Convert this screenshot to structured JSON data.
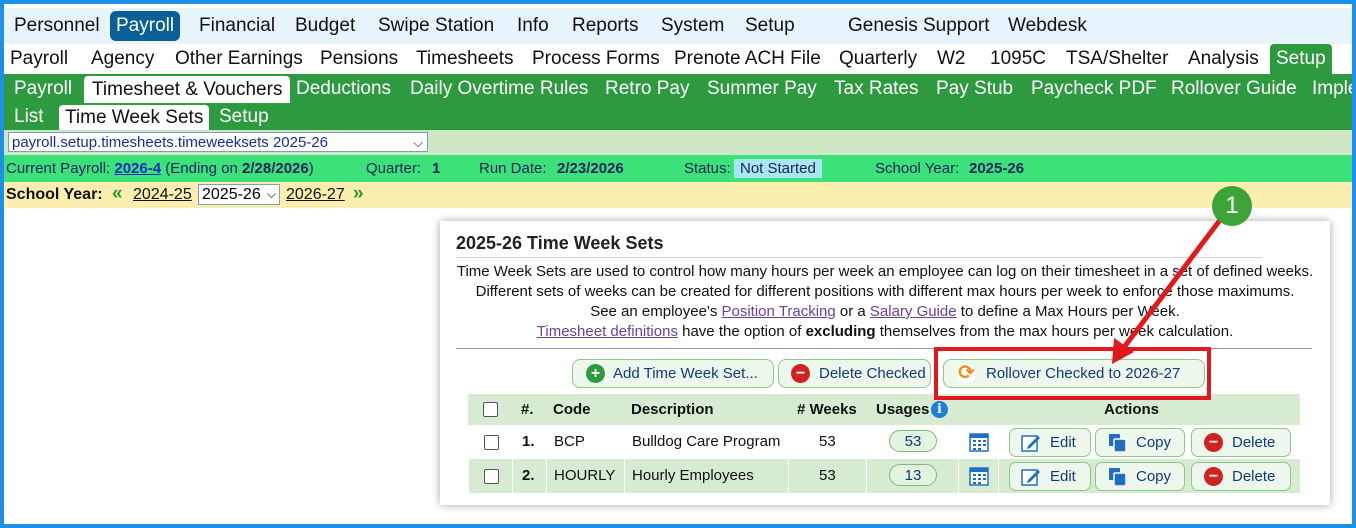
{
  "top_menu": [
    "Personnel",
    "Payroll",
    "Financial",
    "Budget",
    "Swipe Station",
    "Info",
    "Reports",
    "System",
    "Setup",
    "Genesis Support",
    "Webdesk"
  ],
  "sub_menu": [
    "Payroll",
    "Agency",
    "Other Earnings",
    "Pensions",
    "Timesheets",
    "Process Forms",
    "Prenote ACH File",
    "Quarterly",
    "W2",
    "1095C",
    "TSA/Shelter",
    "Analysis",
    "Setup"
  ],
  "setup_menu": [
    "Payroll",
    "Timesheet & Vouchers",
    "Deductions",
    "Daily Overtime Rules",
    "Retro Pay",
    "Summer Pay",
    "Tax Rates",
    "Pay Stub",
    "Paycheck PDF",
    "Rollover Guide",
    "Imple"
  ],
  "third_menu": [
    "List",
    "Time Week Sets",
    "Setup"
  ],
  "path_select": "payroll.setup.timesheets.timeweeksets 2025-26",
  "status": {
    "current_payroll_label": "Current Payroll:",
    "current_payroll": "2026-4",
    "ending": "(Ending on",
    "ending_date": "2/28/2026",
    "ending_close": ")",
    "quarter_label": "Quarter:",
    "quarter": "1",
    "run_date_label": "Run Date:",
    "run_date": "2/23/2026",
    "status_label": "Status:",
    "status": "Not Started",
    "school_year_label": "School Year:",
    "school_year": "2025-26"
  },
  "year_bar": {
    "label": "School Year:",
    "prev": "2024-25",
    "current": "2025-26",
    "next": "2026-27"
  },
  "panel": {
    "title": "2025-26 Time Week Sets",
    "line1": "Time Week Sets are used to control how many hours per week an employee can log on their timesheet in a set of defined weeks.",
    "line2": "Different sets of weeks can be created for different positions with different max hours per week to enforce those maximums.",
    "line3_a": "See an employee's ",
    "line3_link1": "Position Tracking",
    "line3_b": " or a ",
    "line3_link2": "Salary Guide",
    "line3_c": " to define a Max Hours per Week.",
    "line4_link": "Timesheet definitions",
    "line4_a": " have the option of ",
    "line4_bold": "excluding",
    "line4_b": " themselves from the max hours per week calculation.",
    "add_button": "Add Time Week Set...",
    "delete_button": "Delete Checked",
    "rollover_button": "Rollover Checked to 2026-27"
  },
  "table": {
    "headers": {
      "num": "#.",
      "code": "Code",
      "description": "Description",
      "weeks": "# Weeks",
      "usages": "Usages",
      "actions": "Actions"
    },
    "rows": [
      {
        "num": "1.",
        "code": "BCP",
        "description": "Bulldog Care Program",
        "weeks": "53",
        "usages": "53"
      },
      {
        "num": "2.",
        "code": "HOURLY",
        "description": "Hourly Employees",
        "weeks": "53",
        "usages": "13"
      }
    ],
    "edit": "Edit",
    "copy": "Copy",
    "delete": "Delete"
  },
  "annotation": {
    "marker": "1"
  },
  "colors": {
    "brand_blue": "#0a5f96",
    "green": "#2e9a40",
    "status_green": "#3de179",
    "highlight_red": "#e0191e"
  }
}
